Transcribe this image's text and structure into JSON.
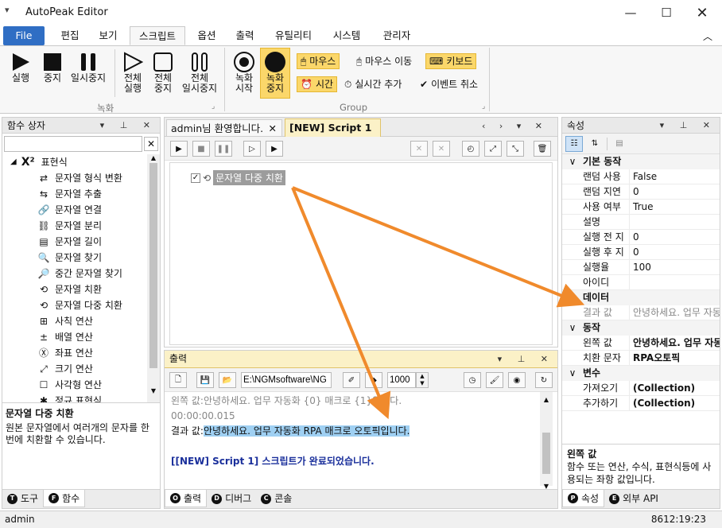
{
  "window": {
    "title": "AutoPeak Editor"
  },
  "menu": {
    "file": "File",
    "items": [
      "편집",
      "보기",
      "스크립트",
      "옵션",
      "출력",
      "유틸리티",
      "시스템",
      "관리자"
    ]
  },
  "ribbon": {
    "rec_group_label": "녹화",
    "group_label": "Group",
    "run": "실행",
    "stop": "중지",
    "pause": "일시중지",
    "run_all": "전체\n실행",
    "stop_all": "전체\n중지",
    "pause_all": "전체\n일시중지",
    "rec_start": "녹화\n시작",
    "rec_stop": "녹화\n중지",
    "mouse": "마우스",
    "mouse_move": "마우스 이동",
    "keyboard": "키보드",
    "time": "시간",
    "realtime_add": "실시간 추가",
    "event_cancel": "이벤트 취소"
  },
  "left": {
    "title": "함수 상자",
    "search_value": "",
    "category": "표현식",
    "items": [
      "문자열 형식 변환",
      "문자열 추출",
      "문자열 연결",
      "문자열 분리",
      "문자열 길이",
      "문자열 찾기",
      "중간 문자열 찾기",
      "문자열 치환",
      "문자열 다중 치환",
      "사칙 연산",
      "배열 연산",
      "좌표 연산",
      "크기 연산",
      "사각형 연산",
      "정규 표현식"
    ],
    "desc_title": "문자열 다중 치환",
    "desc_text": "원본 문자열에서 여러개의 문자를 한번에 치환할 수 있습니다.",
    "tabs": [
      "도구",
      "함수"
    ]
  },
  "doc": {
    "tabs": [
      "admin님 환영합니다.",
      "[NEW] Script 1"
    ],
    "node_label": "문자열 다중 치환"
  },
  "output": {
    "title": "출력",
    "path": "E:\\NGMsoftware\\NG",
    "number": "1000",
    "lines": [
      "왼쪽 값:안녕하세요. 업무 자동화 {0} 매크로 {1}입니다.",
      "00:00:00.015"
    ],
    "result_prefix": "결과 값:",
    "result_value": "안녕하세요. 업무 자동화 RPA 매크로 오토픽입니다.",
    "done": "[[NEW] Script 1] 스크립트가 완료되었습니다.",
    "tabs": [
      "출력",
      "디버그",
      "콘솔"
    ]
  },
  "props": {
    "title": "속성",
    "cats": {
      "basic": "기본 동작",
      "data": "데이터",
      "action": "동작",
      "vars": "변수"
    },
    "basic": [
      {
        "k": "랜덤 사용",
        "v": "False"
      },
      {
        "k": "랜덤 지연",
        "v": "0"
      },
      {
        "k": "사용 여부",
        "v": "True"
      },
      {
        "k": "설명",
        "v": ""
      },
      {
        "k": "실행 전 지",
        "v": "0"
      },
      {
        "k": "실행 후 지",
        "v": "0"
      },
      {
        "k": "실행율",
        "v": "100"
      },
      {
        "k": "아이디",
        "v": ""
      }
    ],
    "data": [
      {
        "k": "결과 값",
        "v": "안녕하세요. 업무 자동"
      }
    ],
    "action": [
      {
        "k": "왼쪽 값",
        "v": "안녕하세요. 업무 자동"
      },
      {
        "k": "치환 문자",
        "v": "RPA오토픽"
      }
    ],
    "vars": [
      {
        "k": "가져오기",
        "v": "(Collection)"
      },
      {
        "k": "추가하기",
        "v": "(Collection)"
      }
    ],
    "desc_title": "왼쪽 값",
    "desc_text": "함수 또는 연산, 수식, 표현식등에 사용되는 좌항 값입니다.",
    "tabs": [
      "속성",
      "외부 API"
    ]
  },
  "status": {
    "user": "admin",
    "time": "8612:19:23"
  },
  "colors": {
    "accent": "#2f6ec4",
    "arrow": "#f08a2c",
    "highlight": "#fbd76a",
    "selection": "#9fd0f3"
  }
}
